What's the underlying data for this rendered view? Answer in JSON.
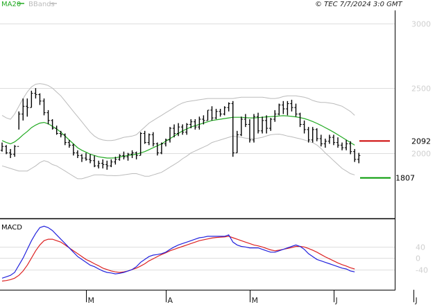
{
  "header": {
    "legend": [
      {
        "label": "MA20",
        "color": "#22aa22"
      },
      {
        "label": "BBands",
        "color": "#bbbbbb"
      }
    ],
    "copyright": "© TEC 7/7/2024 3:0 GMT"
  },
  "colors": {
    "price_bar": "#000000",
    "ma": "#22aa22",
    "bbands": "#bbbbbb",
    "resistance": "#cc0000",
    "support": "#009900",
    "macd": "#2222dd",
    "signal": "#dd2222"
  },
  "chart_data": [
    {
      "type": "bar",
      "title": "",
      "y_ticks": [
        "3000",
        "2500",
        "2000"
      ],
      "y_tick_values": [
        3000,
        2500,
        2000
      ],
      "ylim": [
        1500,
        3100
      ],
      "x_ticks": [
        "M",
        "A",
        "M",
        "J",
        "J"
      ],
      "x_tick_index": [
        20,
        39,
        59,
        79,
        98
      ],
      "grid": true,
      "levels": [
        {
          "name": "resistance",
          "label": "2092",
          "value": 2092
        },
        {
          "name": "support",
          "label": "1807",
          "value": 1807
        }
      ],
      "ohlc": [
        [
          2020,
          2080,
          2010,
          2050
        ],
        [
          2050,
          2060,
          1990,
          2000
        ],
        [
          2000,
          2030,
          1960,
          1990
        ],
        [
          1990,
          2060,
          1970,
          2050
        ],
        [
          2050,
          2320,
          2180,
          2300
        ],
        [
          2300,
          2420,
          2250,
          2360
        ],
        [
          2360,
          2420,
          2280,
          2350
        ],
        [
          2350,
          2480,
          2350,
          2460
        ],
        [
          2460,
          2500,
          2420,
          2450
        ],
        [
          2450,
          2460,
          2370,
          2400
        ],
        [
          2400,
          2420,
          2290,
          2310
        ],
        [
          2310,
          2330,
          2220,
          2250
        ],
        [
          2250,
          2260,
          2180,
          2190
        ],
        [
          2190,
          2210,
          2140,
          2150
        ],
        [
          2150,
          2170,
          2120,
          2140
        ],
        [
          2140,
          2150,
          2060,
          2080
        ],
        [
          2080,
          2100,
          2040,
          2060
        ],
        [
          2060,
          2070,
          1980,
          2000
        ],
        [
          2000,
          2020,
          1960,
          1980
        ],
        [
          1980,
          1990,
          1930,
          1960
        ],
        [
          1960,
          2000,
          1940,
          1950
        ],
        [
          1950,
          1990,
          1920,
          1940
        ],
        [
          1940,
          1980,
          1890,
          1900
        ],
        [
          1900,
          1940,
          1880,
          1920
        ],
        [
          1920,
          1950,
          1880,
          1910
        ],
        [
          1910,
          1940,
          1870,
          1900
        ],
        [
          1900,
          1950,
          1890,
          1930
        ],
        [
          1930,
          1970,
          1910,
          1950
        ],
        [
          1950,
          1990,
          1940,
          1980
        ],
        [
          1980,
          2010,
          1950,
          1970
        ],
        [
          1970,
          2000,
          1940,
          1990
        ],
        [
          1990,
          2020,
          1960,
          2000
        ],
        [
          2000,
          2010,
          1950,
          1980
        ],
        [
          1980,
          2160,
          1980,
          2150
        ],
        [
          2150,
          2170,
          2070,
          2080
        ],
        [
          2080,
          2150,
          2060,
          2140
        ],
        [
          2140,
          2160,
          2050,
          2070
        ],
        [
          2070,
          2080,
          1980,
          2000
        ],
        [
          2000,
          2080,
          1990,
          2070
        ],
        [
          2070,
          2110,
          2050,
          2100
        ],
        [
          2100,
          2200,
          2080,
          2190
        ],
        [
          2190,
          2220,
          2120,
          2150
        ],
        [
          2150,
          2230,
          2130,
          2200
        ],
        [
          2200,
          2220,
          2140,
          2160
        ],
        [
          2160,
          2230,
          2140,
          2220
        ],
        [
          2220,
          2260,
          2190,
          2240
        ],
        [
          2240,
          2260,
          2180,
          2200
        ],
        [
          2200,
          2280,
          2180,
          2260
        ],
        [
          2260,
          2290,
          2220,
          2250
        ],
        [
          2250,
          2330,
          2250,
          2330
        ],
        [
          2330,
          2360,
          2250,
          2270
        ],
        [
          2270,
          2340,
          2260,
          2320
        ],
        [
          2320,
          2340,
          2280,
          2300
        ],
        [
          2300,
          2360,
          2290,
          2350
        ],
        [
          2350,
          2390,
          2320,
          2380
        ],
        [
          2380,
          2400,
          1970,
          2000
        ],
        [
          2000,
          2170,
          2000,
          2140
        ],
        [
          2140,
          2280,
          2130,
          2260
        ],
        [
          2260,
          2300,
          2200,
          2220
        ],
        [
          2220,
          2260,
          2080,
          2100
        ],
        [
          2100,
          2300,
          2080,
          2280
        ],
        [
          2280,
          2310,
          2150,
          2170
        ],
        [
          2170,
          2280,
          2150,
          2250
        ],
        [
          2250,
          2290,
          2150,
          2190
        ],
        [
          2190,
          2270,
          2170,
          2260
        ],
        [
          2260,
          2330,
          2240,
          2300
        ],
        [
          2300,
          2380,
          2290,
          2370
        ],
        [
          2370,
          2400,
          2300,
          2340
        ],
        [
          2340,
          2400,
          2290,
          2380
        ],
        [
          2380,
          2410,
          2320,
          2350
        ],
        [
          2350,
          2380,
          2280,
          2300
        ],
        [
          2300,
          2310,
          2200,
          2220
        ],
        [
          2220,
          2250,
          2150,
          2180
        ],
        [
          2180,
          2200,
          2080,
          2100
        ],
        [
          2100,
          2200,
          2080,
          2180
        ],
        [
          2180,
          2190,
          2090,
          2110
        ],
        [
          2110,
          2140,
          2050,
          2070
        ],
        [
          2070,
          2110,
          2040,
          2090
        ],
        [
          2090,
          2140,
          2070,
          2120
        ],
        [
          2120,
          2140,
          2060,
          2080
        ],
        [
          2080,
          2120,
          2040,
          2060
        ],
        [
          2060,
          2080,
          2020,
          2040
        ],
        [
          2040,
          2100,
          2020,
          2070
        ],
        [
          2070,
          2090,
          1990,
          2010
        ],
        [
          2010,
          2030,
          1930,
          1950
        ],
        [
          1950,
          2000,
          1920,
          1980
        ]
      ],
      "ma20": [
        2095,
        2080,
        2070,
        2085,
        2110,
        2140,
        2165,
        2195,
        2215,
        2230,
        2235,
        2225,
        2205,
        2185,
        2160,
        2130,
        2100,
        2070,
        2040,
        2020,
        2005,
        1990,
        1980,
        1970,
        1965,
        1960,
        1960,
        1962,
        1968,
        1975,
        1980,
        1985,
        1990,
        2000,
        2010,
        2025,
        2040,
        2055,
        2070,
        2090,
        2110,
        2130,
        2150,
        2170,
        2185,
        2200,
        2210,
        2220,
        2230,
        2240,
        2250,
        2255,
        2260,
        2265,
        2270,
        2275,
        2275,
        2275,
        2272,
        2270,
        2270,
        2272,
        2275,
        2278,
        2280,
        2282,
        2285,
        2287,
        2285,
        2282,
        2278,
        2272,
        2265,
        2255,
        2242,
        2228,
        2212,
        2195,
        2178,
        2160,
        2140,
        2120,
        2100,
        2080,
        2060
      ],
      "bb_upper": [
        2290,
        2270,
        2260,
        2300,
        2360,
        2420,
        2470,
        2510,
        2530,
        2535,
        2530,
        2520,
        2500,
        2470,
        2440,
        2400,
        2360,
        2320,
        2280,
        2240,
        2200,
        2160,
        2130,
        2110,
        2100,
        2095,
        2095,
        2100,
        2110,
        2120,
        2125,
        2130,
        2140,
        2170,
        2200,
        2230,
        2250,
        2270,
        2290,
        2310,
        2330,
        2350,
        2370,
        2385,
        2395,
        2400,
        2405,
        2410,
        2415,
        2420,
        2420,
        2420,
        2420,
        2420,
        2420,
        2420,
        2425,
        2430,
        2430,
        2430,
        2430,
        2430,
        2430,
        2425,
        2420,
        2420,
        2425,
        2435,
        2440,
        2440,
        2440,
        2435,
        2430,
        2420,
        2405,
        2395,
        2390,
        2390,
        2385,
        2380,
        2370,
        2360,
        2340,
        2320,
        2290
      ],
      "bb_lower": [
        1900,
        1890,
        1880,
        1870,
        1860,
        1860,
        1860,
        1880,
        1900,
        1925,
        1940,
        1930,
        1910,
        1900,
        1880,
        1860,
        1840,
        1820,
        1800,
        1800,
        1810,
        1820,
        1830,
        1830,
        1830,
        1825,
        1825,
        1824,
        1826,
        1830,
        1835,
        1840,
        1840,
        1830,
        1820,
        1820,
        1830,
        1840,
        1850,
        1870,
        1890,
        1910,
        1930,
        1955,
        1975,
        2000,
        2015,
        2030,
        2045,
        2060,
        2080,
        2090,
        2100,
        2110,
        2120,
        2130,
        2125,
        2120,
        2114,
        2110,
        2110,
        2114,
        2120,
        2131,
        2140,
        2144,
        2145,
        2139,
        2130,
        2124,
        2116,
        2109,
        2100,
        2090,
        2079,
        2061,
        2034,
        2000,
        1971,
        1940,
        1910,
        1880,
        1860,
        1840,
        1830
      ]
    },
    {
      "type": "line",
      "title": "MACD",
      "y_ticks": [
        "40",
        "0",
        "-40"
      ],
      "y_tick_values": [
        40,
        0,
        -40
      ],
      "ylim": [
        -110,
        130
      ],
      "grid": true,
      "series": [
        {
          "name": "",
          "values": [
            -70,
            -65,
            -60,
            -50,
            -25,
            0,
            30,
            60,
            85,
            105,
            110,
            105,
            95,
            80,
            65,
            50,
            35,
            20,
            5,
            -5,
            -15,
            -25,
            -30,
            -38,
            -45,
            -50,
            -52,
            -55,
            -53,
            -50,
            -45,
            -40,
            -30,
            -15,
            -5,
            5,
            10,
            12,
            15,
            20,
            30,
            38,
            45,
            50,
            55,
            60,
            65,
            70,
            72,
            75,
            75,
            75,
            75,
            75,
            80,
            55,
            45,
            40,
            38,
            35,
            35,
            35,
            30,
            25,
            20,
            20,
            25,
            30,
            35,
            40,
            45,
            40,
            30,
            15,
            5,
            -5,
            -10,
            -15,
            -20,
            -25,
            -30,
            -35,
            -38,
            -45,
            -48
          ]
        },
        {
          "name": "",
          "values": [
            -80,
            -78,
            -75,
            -70,
            -60,
            -45,
            -25,
            0,
            25,
            45,
            60,
            65,
            65,
            60,
            55,
            45,
            35,
            25,
            15,
            5,
            -5,
            -12,
            -20,
            -27,
            -35,
            -40,
            -45,
            -48,
            -50,
            -48,
            -45,
            -40,
            -35,
            -28,
            -20,
            -10,
            -3,
            5,
            12,
            18,
            25,
            30,
            35,
            40,
            45,
            50,
            55,
            60,
            63,
            66,
            69,
            71,
            72,
            73,
            75,
            70,
            65,
            60,
            55,
            50,
            45,
            42,
            38,
            33,
            28,
            25,
            27,
            30,
            33,
            36,
            40,
            40,
            38,
            33,
            27,
            20,
            12,
            4,
            -3,
            -10,
            -17,
            -23,
            -28,
            -34,
            -38
          ]
        }
      ]
    }
  ]
}
